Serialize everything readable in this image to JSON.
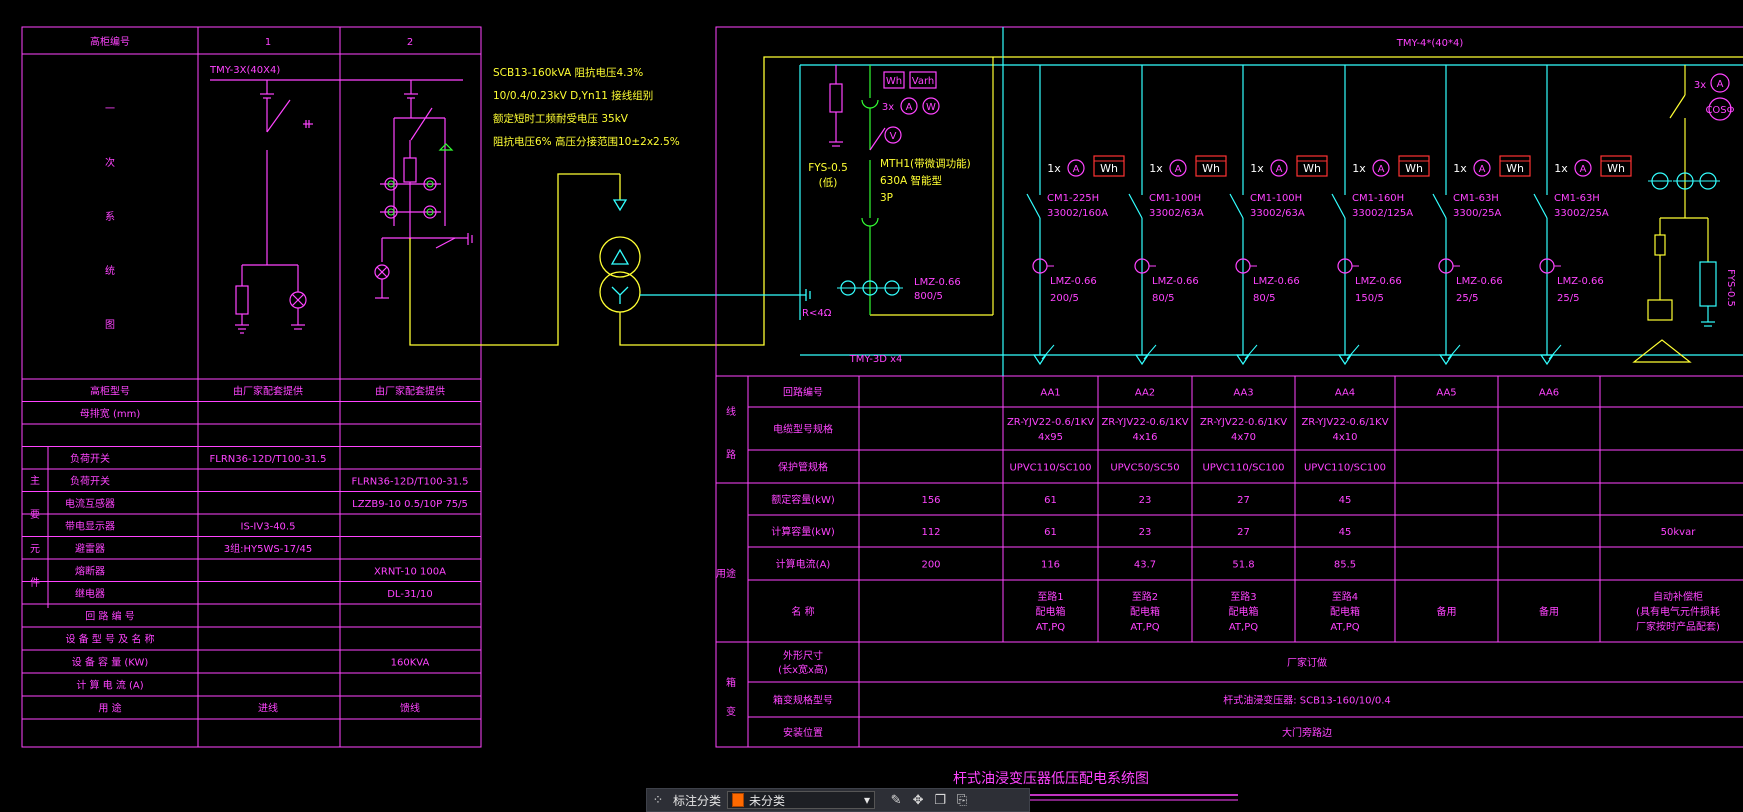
{
  "drawing": {
    "title": "杆式油浸变压器低压配电系统图",
    "left_table": {
      "header": {
        "label": "高柜编号",
        "col1": "1",
        "col2": "2"
      },
      "diagram_label_chars": [
        "一",
        "次",
        "系",
        "统",
        "图"
      ],
      "busbar_label": "TMY-3X(40X4)",
      "rows": [
        {
          "label": "高柜型号",
          "v1": "由厂家配套提供",
          "v2": "由厂家配套提供"
        },
        {
          "label": "母排宽 (mm)",
          "v1": "",
          "v2": ""
        },
        {
          "label": "",
          "v1": "",
          "v2": ""
        },
        {
          "label": "负荷开关",
          "v1": "FLRN36-12D/T100-31.5",
          "v2": ""
        },
        {
          "label": "负荷开关",
          "v1": "",
          "v2": "FLRN36-12D/T100-31.5"
        },
        {
          "label": "电流互感器",
          "v1": "",
          "v2": "LZZB9-10 0.5/10P 75/5"
        },
        {
          "label": "带电显示器",
          "v1": "IS-IV3-40.5",
          "v2": ""
        },
        {
          "label": "避雷器",
          "v1": "3组:HY5WS-17/45",
          "v2": ""
        },
        {
          "label": "熔断器",
          "v1": "",
          "v2": "XRNT-10 100A"
        },
        {
          "label": "继电器",
          "v1": "",
          "v2": "DL-31/10"
        },
        {
          "label": "回 路 编 号",
          "v1": "",
          "v2": ""
        },
        {
          "label": "设 备 型 号 及 名 称",
          "v1": "",
          "v2": ""
        },
        {
          "label": "设 备 容 量 (KW)",
          "v1": "",
          "v2": "160KVA"
        },
        {
          "label": "计 算 电 流 (A)",
          "v1": "",
          "v2": ""
        },
        {
          "label": "用 途",
          "v1": "进线",
          "v2": "馈线"
        },
        {
          "label": "",
          "v1": "",
          "v2": ""
        }
      ],
      "group_label_chars": [
        "主",
        "要",
        "元",
        "件"
      ]
    },
    "transformer": {
      "spec_lines": [
        "SCB13-160kVA  阻抗电压4.3%",
        "10/0.4/0.23kV  D,Yn11  接线组别",
        "额定短时工频耐受电压 35kV",
        "阻抗电压6%  高压分接范围10±2x2.5%"
      ]
    },
    "incoming": {
      "busbar_top": "TMY-4*(40*4)",
      "busbar_bottom": "TMY-3D x4",
      "meters": [
        "Wh",
        "Varh"
      ],
      "meter_labels": [
        "3x",
        "A",
        "W",
        "V"
      ],
      "surge": "FYS-0.5",
      "surge_note": "(低)",
      "breaker_lines": [
        "MTH1(带微调功能)",
        "630A  智能型",
        "3P"
      ],
      "ct": [
        "LMZ-0.66",
        "800/5"
      ],
      "ground": "R<4Ω"
    },
    "feeders": [
      {
        "breaker": [
          "CM1-225H",
          "33002/160A"
        ],
        "ct": [
          "LMZ-0.66",
          "200/5"
        ]
      },
      {
        "breaker": [
          "CM1-100H",
          "33002/63A"
        ],
        "ct": [
          "LMZ-0.66",
          "80/5"
        ]
      },
      {
        "breaker": [
          "CM1-100H",
          "33002/63A"
        ],
        "ct": [
          "LMZ-0.66",
          "80/5"
        ]
      },
      {
        "breaker": [
          "CM1-160H",
          "33002/125A"
        ],
        "ct": [
          "LMZ-0.66",
          "150/5"
        ]
      },
      {
        "breaker": [
          "CM1-63H",
          "3300/25A"
        ],
        "ct": [
          "LMZ-0.66",
          "25/5"
        ]
      },
      {
        "breaker": [
          "CM1-63H",
          "33002/25A"
        ],
        "ct": [
          "LMZ-0.66",
          "25/5"
        ]
      }
    ],
    "feeder_meter": {
      "count": "1x",
      "amp": "A",
      "wh": "Wh"
    },
    "capacitor": {
      "count": "3x",
      "amp": "A",
      "cos": "COSΦ",
      "surge": "FYS-0.5"
    },
    "right_table": {
      "group_left": [
        "线",
        "路"
      ],
      "group_mid": "用途",
      "group_bottom": [
        "箱",
        "变"
      ],
      "rows": [
        {
          "label": "回路编号",
          "values": [
            "",
            "AA1",
            "AA2",
            "AA3",
            "AA4",
            "AA5",
            "AA6",
            ""
          ]
        },
        {
          "label": "电缆型号规格",
          "values": [
            "",
            "ZR-YJV22-0.6/1KV|4x95",
            "ZR-YJV22-0.6/1KV|4x16",
            "ZR-YJV22-0.6/1KV|4x70",
            "ZR-YJV22-0.6/1KV|4x10",
            "",
            "",
            ""
          ]
        },
        {
          "label": "保护管规格",
          "values": [
            "",
            "UPVC110/SC100",
            "UPVC50/SC50",
            "UPVC110/SC100",
            "UPVC110/SC100",
            "",
            "",
            ""
          ]
        },
        {
          "label": "额定容量(kW)",
          "values": [
            "156",
            "61",
            "23",
            "27",
            "45",
            "",
            "",
            ""
          ]
        },
        {
          "label": "计算容量(kW)",
          "values": [
            "112",
            "61",
            "23",
            "27",
            "45",
            "",
            "",
            "50kvar"
          ]
        },
        {
          "label": "计算电流(A)",
          "values": [
            "200",
            "116",
            "43.7",
            "51.8",
            "85.5",
            "",
            "",
            ""
          ]
        },
        {
          "label": "名  称",
          "values": [
            "",
            "至路1|配电箱|AT,PQ",
            "至路2|配电箱|AT,PQ",
            "至路3|配电箱|AT,PQ",
            "至路4|配电箱|AT,PQ",
            "备用",
            "备用",
            "自动补偿柜|(具有电气元件损耗|厂家按时产品配套)"
          ]
        },
        {
          "label": "外形尺寸|(长x宽x高)",
          "span": "厂家订做"
        },
        {
          "label": "箱变规格型号",
          "span": "杆式油浸变压器: SCB13-160/10/0.4"
        },
        {
          "label": "安装位置",
          "span": "大门旁路边"
        }
      ]
    }
  },
  "toolbar": {
    "icons": [
      "grid-icon",
      "edit-icon",
      "move-icon",
      "copy-icon",
      "paste-icon"
    ],
    "label": "标注分类",
    "selected": "未分类",
    "selected_color": "#ff6a00"
  },
  "colors": {
    "magenta": "#ff44ff",
    "yellow": "#ffff33",
    "cyan": "#33ffff",
    "red": "#ff3333",
    "background": "#000000"
  }
}
